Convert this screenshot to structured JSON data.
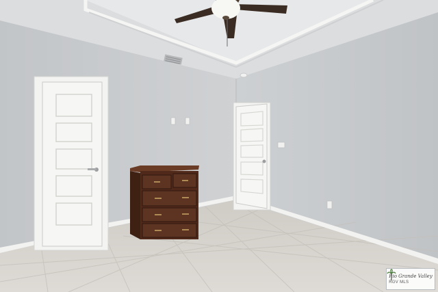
{
  "scene": {
    "type": "interior-photo",
    "room": "empty bedroom",
    "elements": [
      "ceiling-fan",
      "tray-ceiling",
      "air-vent",
      "smoke-detector",
      "closet-door",
      "bedroom-door",
      "wooden-dresser",
      "light-switches",
      "electrical-outlet",
      "tile-floor",
      "baseboards"
    ]
  },
  "colors": {
    "wall": "#c9cbcd",
    "wall_right": "#c3c6c9",
    "ceiling": "#e2e3e4",
    "trim": "#f4f4f2",
    "floor": "#d9d6d1",
    "dresser": "#4e2a1a",
    "fan_blade": "#3a2c22"
  },
  "watermark": {
    "line1": "Rio Grande Valley",
    "line2": "RGV MLS"
  }
}
